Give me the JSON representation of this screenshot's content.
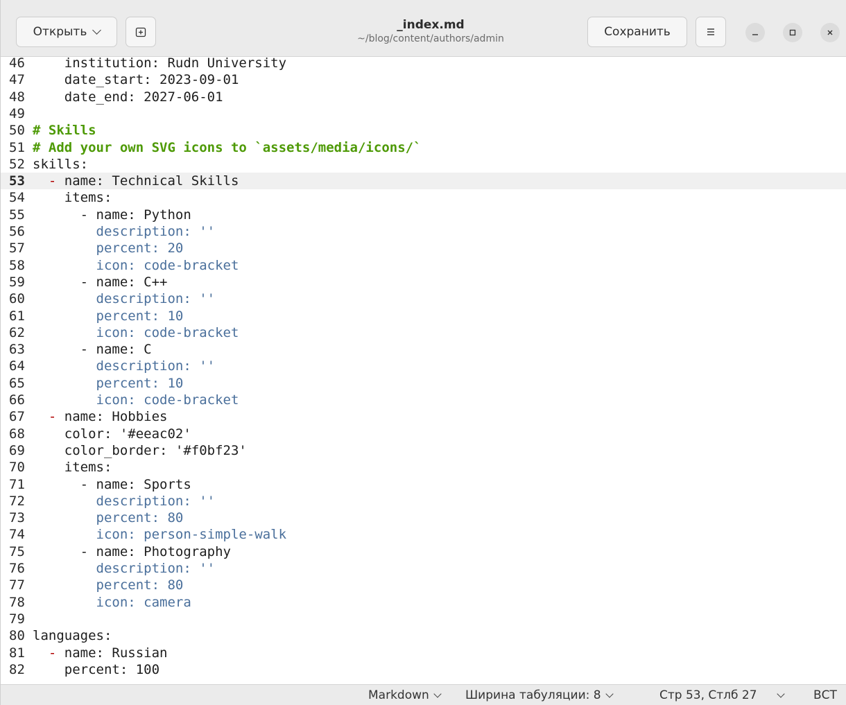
{
  "window": {
    "title": "_index.md",
    "subtitle": "~/blog/content/authors/admin"
  },
  "toolbar": {
    "open_label": "Открыть",
    "save_label": "Сохранить"
  },
  "editor": {
    "current_line": "53",
    "lines": [
      {
        "n": "46",
        "segments": [
          {
            "t": "    institution: Rudn University",
            "c": "plain"
          }
        ]
      },
      {
        "n": "47",
        "segments": [
          {
            "t": "    date_start: 2023-09-01",
            "c": "plain"
          }
        ]
      },
      {
        "n": "48",
        "segments": [
          {
            "t": "    date_end: 2027-06-01",
            "c": "plain"
          }
        ]
      },
      {
        "n": "49",
        "segments": []
      },
      {
        "n": "50",
        "segments": [
          {
            "t": "# Skills",
            "c": "comment"
          }
        ]
      },
      {
        "n": "51",
        "segments": [
          {
            "t": "# Add your own SVG icons to `assets/media/icons/`",
            "c": "comment"
          }
        ]
      },
      {
        "n": "52",
        "segments": [
          {
            "t": "skills:",
            "c": "plain"
          }
        ]
      },
      {
        "n": "53",
        "segments": [
          {
            "t": "  ",
            "c": "plain"
          },
          {
            "t": "-",
            "c": "dash"
          },
          {
            "t": " name: Technical Skills",
            "c": "plain"
          }
        ]
      },
      {
        "n": "54",
        "segments": [
          {
            "t": "    items:",
            "c": "plain"
          }
        ]
      },
      {
        "n": "55",
        "segments": [
          {
            "t": "      - name: Python",
            "c": "plain"
          }
        ]
      },
      {
        "n": "56",
        "segments": [
          {
            "t": "        ",
            "c": "plain"
          },
          {
            "t": "description: ''",
            "c": "val"
          }
        ]
      },
      {
        "n": "57",
        "segments": [
          {
            "t": "        ",
            "c": "plain"
          },
          {
            "t": "percent: 20",
            "c": "val"
          }
        ]
      },
      {
        "n": "58",
        "segments": [
          {
            "t": "        ",
            "c": "plain"
          },
          {
            "t": "icon: code-bracket",
            "c": "val"
          }
        ]
      },
      {
        "n": "59",
        "segments": [
          {
            "t": "      - name: C++",
            "c": "plain"
          }
        ]
      },
      {
        "n": "60",
        "segments": [
          {
            "t": "        ",
            "c": "plain"
          },
          {
            "t": "description: ''",
            "c": "val"
          }
        ]
      },
      {
        "n": "61",
        "segments": [
          {
            "t": "        ",
            "c": "plain"
          },
          {
            "t": "percent: 10",
            "c": "val"
          }
        ]
      },
      {
        "n": "62",
        "segments": [
          {
            "t": "        ",
            "c": "plain"
          },
          {
            "t": "icon: code-bracket",
            "c": "val"
          }
        ]
      },
      {
        "n": "63",
        "segments": [
          {
            "t": "      - name: C",
            "c": "plain"
          }
        ]
      },
      {
        "n": "64",
        "segments": [
          {
            "t": "        ",
            "c": "plain"
          },
          {
            "t": "description: ''",
            "c": "val"
          }
        ]
      },
      {
        "n": "65",
        "segments": [
          {
            "t": "        ",
            "c": "plain"
          },
          {
            "t": "percent: 10",
            "c": "val"
          }
        ]
      },
      {
        "n": "66",
        "segments": [
          {
            "t": "        ",
            "c": "plain"
          },
          {
            "t": "icon: code-bracket",
            "c": "val"
          }
        ]
      },
      {
        "n": "67",
        "segments": [
          {
            "t": "  ",
            "c": "plain"
          },
          {
            "t": "-",
            "c": "dash"
          },
          {
            "t": " name: Hobbies",
            "c": "plain"
          }
        ]
      },
      {
        "n": "68",
        "segments": [
          {
            "t": "    color: '#eeac02'",
            "c": "plain"
          }
        ]
      },
      {
        "n": "69",
        "segments": [
          {
            "t": "    color_border: '#f0bf23'",
            "c": "plain"
          }
        ]
      },
      {
        "n": "70",
        "segments": [
          {
            "t": "    items:",
            "c": "plain"
          }
        ]
      },
      {
        "n": "71",
        "segments": [
          {
            "t": "      - name: Sports",
            "c": "plain"
          }
        ]
      },
      {
        "n": "72",
        "segments": [
          {
            "t": "        ",
            "c": "plain"
          },
          {
            "t": "description: ''",
            "c": "val"
          }
        ]
      },
      {
        "n": "73",
        "segments": [
          {
            "t": "        ",
            "c": "plain"
          },
          {
            "t": "percent: 80",
            "c": "val"
          }
        ]
      },
      {
        "n": "74",
        "segments": [
          {
            "t": "        ",
            "c": "plain"
          },
          {
            "t": "icon: person-simple-walk",
            "c": "val"
          }
        ]
      },
      {
        "n": "75",
        "segments": [
          {
            "t": "      - name: Photography",
            "c": "plain"
          }
        ]
      },
      {
        "n": "76",
        "segments": [
          {
            "t": "        ",
            "c": "plain"
          },
          {
            "t": "description: ''",
            "c": "val"
          }
        ]
      },
      {
        "n": "77",
        "segments": [
          {
            "t": "        ",
            "c": "plain"
          },
          {
            "t": "percent: 80",
            "c": "val"
          }
        ]
      },
      {
        "n": "78",
        "segments": [
          {
            "t": "        ",
            "c": "plain"
          },
          {
            "t": "icon: camera",
            "c": "val"
          }
        ]
      },
      {
        "n": "79",
        "segments": []
      },
      {
        "n": "80",
        "segments": [
          {
            "t": "languages:",
            "c": "plain"
          }
        ]
      },
      {
        "n": "81",
        "segments": [
          {
            "t": "  ",
            "c": "plain"
          },
          {
            "t": "-",
            "c": "dash"
          },
          {
            "t": " name: Russian",
            "c": "plain"
          }
        ]
      },
      {
        "n": "82",
        "segments": [
          {
            "t": "    percent: 100",
            "c": "plain"
          }
        ]
      }
    ]
  },
  "statusbar": {
    "language": "Markdown",
    "tab_width": "Ширина табуляции: 8",
    "cursor": "Стр 53, Стлб 27",
    "insert_mode": "ВСТ"
  },
  "icons": {
    "open_dropdown": "chevron-down-icon",
    "new_tab": "new-tab-icon",
    "menu": "hamburger-menu-icon",
    "minimize": "minimize-icon",
    "maximize": "maximize-icon",
    "close": "close-icon"
  }
}
